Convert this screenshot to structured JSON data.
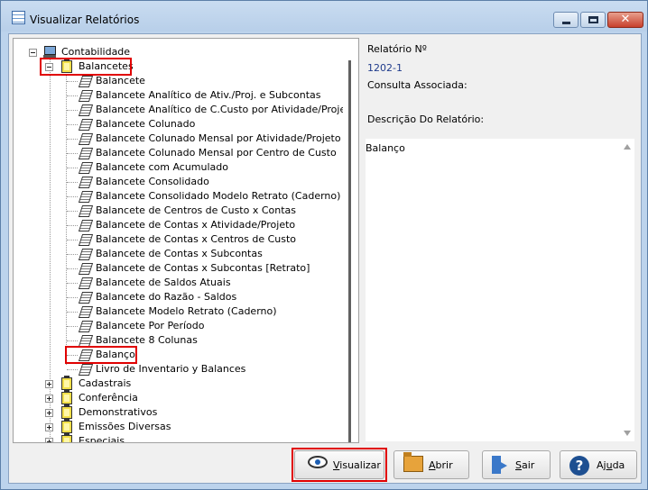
{
  "window": {
    "title": "Visualizar Relatórios",
    "title_icon": "report-grid-icon",
    "controls": {
      "minimize_icon": "minimize-icon",
      "maximize_icon": "maximize-icon",
      "close_icon": "close-icon",
      "close_glyph": "✕"
    }
  },
  "tree": {
    "root": {
      "label": "Contabilidade",
      "icon": "computer-icon"
    },
    "group_open": {
      "label": "Balancetes",
      "icon": "folder-icon"
    },
    "reports": [
      "Balancete",
      "Balancete Analítico de Ativ./Proj. e Subcontas",
      "Balancete Analítico de C.Custo por Atividade/Projeto",
      "Balancete Colunado",
      "Balancete Colunado Mensal por Atividade/Projeto",
      "Balancete Colunado Mensal por Centro de Custo",
      "Balancete com Acumulado",
      "Balancete Consolidado",
      "Balancete Consolidado Modelo Retrato (Caderno)",
      "Balancete de Centros de Custo x Contas",
      "Balancete de Contas x Atividade/Projeto",
      "Balancete de Contas x Centros de Custo",
      "Balancete de Contas x Subcontas",
      "Balancete de Contas x Subcontas [Retrato]",
      "Balancete de Saldos Atuais",
      "Balancete do Razão - Saldos",
      "Balancete Modelo Retrato (Caderno)",
      "Balancete Por Período",
      "Balancete 8 Colunas",
      "Balanço",
      "Livro de Inventario y Balances"
    ],
    "selected_report": "Balanço",
    "groups_closed": [
      "Cadastrais",
      "Conferência",
      "Demonstrativos",
      "Emissões Diversas",
      "Especiais"
    ]
  },
  "detail": {
    "report_no_label": "Relatório Nº",
    "report_no_value": "1202-1",
    "query_label": "Consulta Associada:",
    "description_label": "Descrição Do Relatório:",
    "description_value": "Balanço"
  },
  "buttons": {
    "visualizar": {
      "prefix": "",
      "accel": "V",
      "rest": "isualizar",
      "icon": "eye-icon"
    },
    "abrir": {
      "prefix": "",
      "accel": "A",
      "rest": "brir",
      "icon": "open-folder-icon"
    },
    "sair": {
      "prefix": "",
      "accel": "S",
      "rest": "air",
      "icon": "exit-door-icon"
    },
    "ajuda": {
      "prefix": "Aj",
      "accel": "u",
      "rest": "da",
      "icon": "help-icon",
      "glyph": "?"
    }
  },
  "colors": {
    "highlight_border": "#e00000",
    "value_text": "#1f3b8c"
  }
}
